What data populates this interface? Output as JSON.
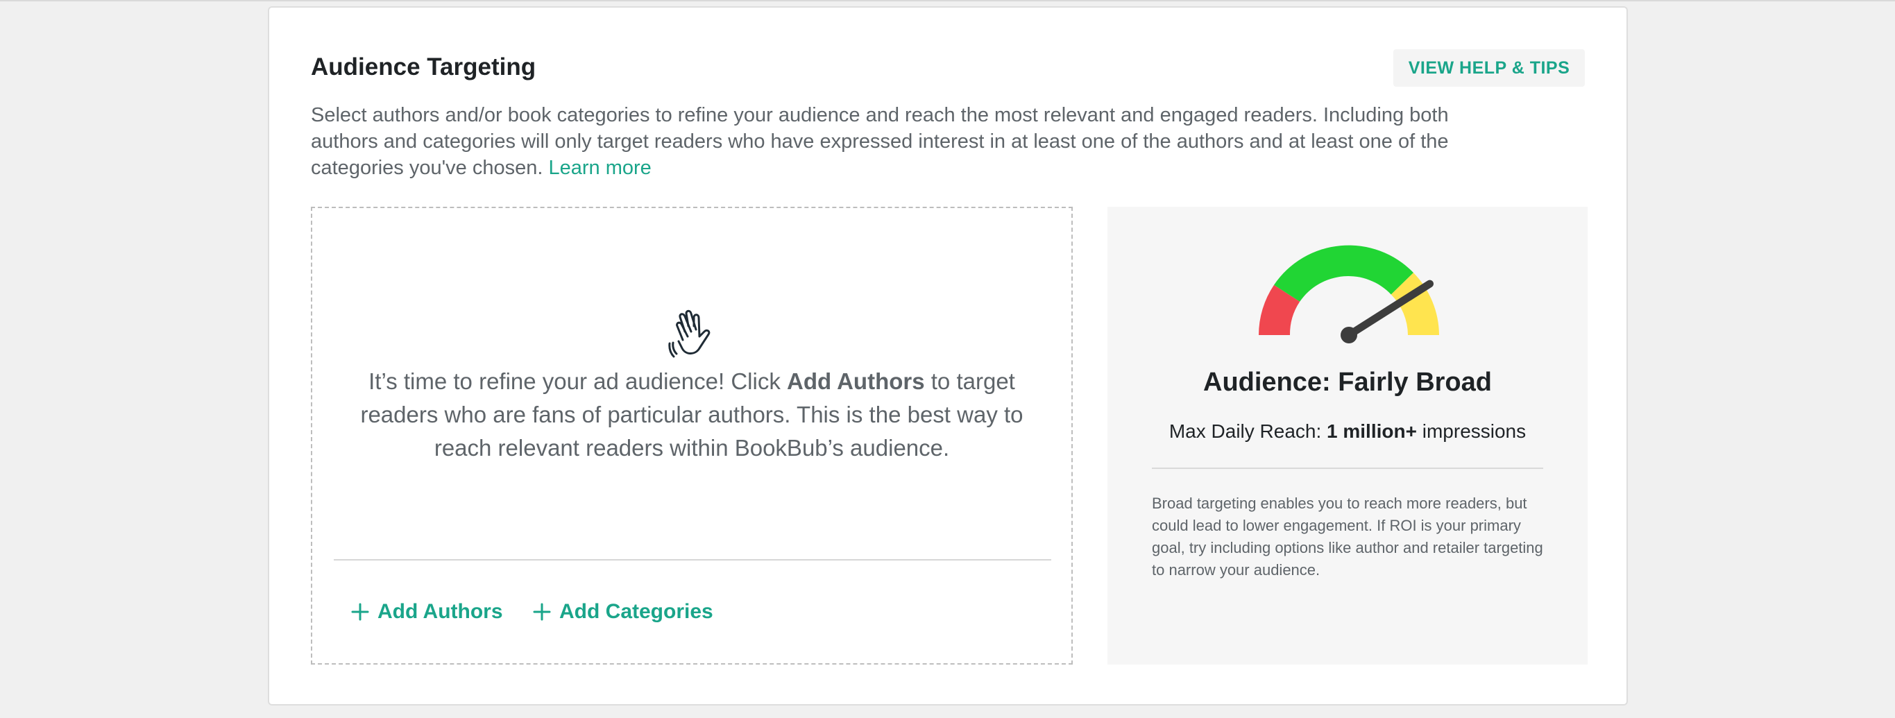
{
  "header": {
    "title": "Audience Targeting",
    "help_button": "VIEW HELP & TIPS"
  },
  "description": {
    "text": "Select authors and/or book categories to refine your audience and reach the most relevant and engaged readers. Including both authors and categories will only target readers who have expressed interest in at least one of the authors and at least one of the categories you've chosen.",
    "learn_more": "Learn more"
  },
  "empty_state": {
    "icon": "waving-hand-icon",
    "prompt_before": "It’s time to refine your ad audience! Click ",
    "prompt_bold": "Add Authors",
    "prompt_after": " to target readers who are fans of particular authors. This is the best way to reach relevant readers within BookBub’s audience.",
    "actions": [
      {
        "label": "Add Authors",
        "icon": "plus-icon"
      },
      {
        "label": "Add Categories",
        "icon": "plus-icon"
      }
    ]
  },
  "reach": {
    "gauge_level": 0.82,
    "gauge_colors": {
      "narrow": "#f0474f",
      "ideal": "#21d534",
      "broad": "#ffe44f",
      "needle": "#3d3d3d"
    },
    "audience_label": "Audience: Fairly Broad",
    "max_reach_prefix": "Max Daily Reach: ",
    "max_reach_value": "1 million+",
    "max_reach_suffix": " impressions",
    "note": "Broad targeting enables you to reach more readers, but could lead to lower engagement. If ROI is your primary goal, try including options like author and retailer targeting to narrow your audience."
  },
  "accent_color": "#1aa58a"
}
